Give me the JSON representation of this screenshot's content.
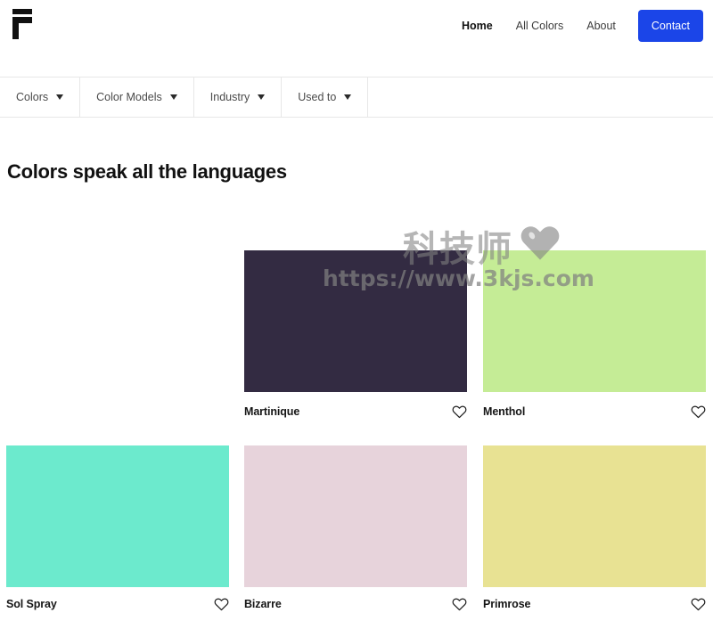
{
  "header": {
    "logo_name": "logo-f-mark",
    "nav": [
      {
        "label": "Home",
        "active": true
      },
      {
        "label": "All Colors",
        "active": false
      },
      {
        "label": "About",
        "active": false
      }
    ],
    "cta_label": "Contact",
    "cta_color": "#1b45e8"
  },
  "filters": [
    {
      "label": "Colors",
      "icon": "chevron-down-icon"
    },
    {
      "label": "Color Models",
      "icon": "chevron-down-icon"
    },
    {
      "label": "Industry",
      "icon": "chevron-down-icon"
    },
    {
      "label": "Used to",
      "icon": "chevron-down-icon"
    }
  ],
  "page_title": "Colors speak all the languages",
  "colors": [
    {
      "name": "Martinique",
      "hex": "#332B42",
      "favorite_icon": "heart-outline-icon"
    },
    {
      "name": "Menthol",
      "hex": "#C5EC96",
      "favorite_icon": "heart-outline-icon"
    },
    {
      "name": "Sol Spray",
      "hex": "#6CEACD",
      "favorite_icon": "heart-outline-icon"
    },
    {
      "name": "Bizarre",
      "hex": "#E7D3DB",
      "favorite_icon": "heart-outline-icon"
    },
    {
      "name": "Primrose",
      "hex": "#E8E293",
      "favorite_icon": "heart-outline-icon"
    }
  ],
  "watermark": {
    "brand": "科技师",
    "url": "https://www.3kjs.com",
    "heart_icon": "heart-filled-icon"
  }
}
